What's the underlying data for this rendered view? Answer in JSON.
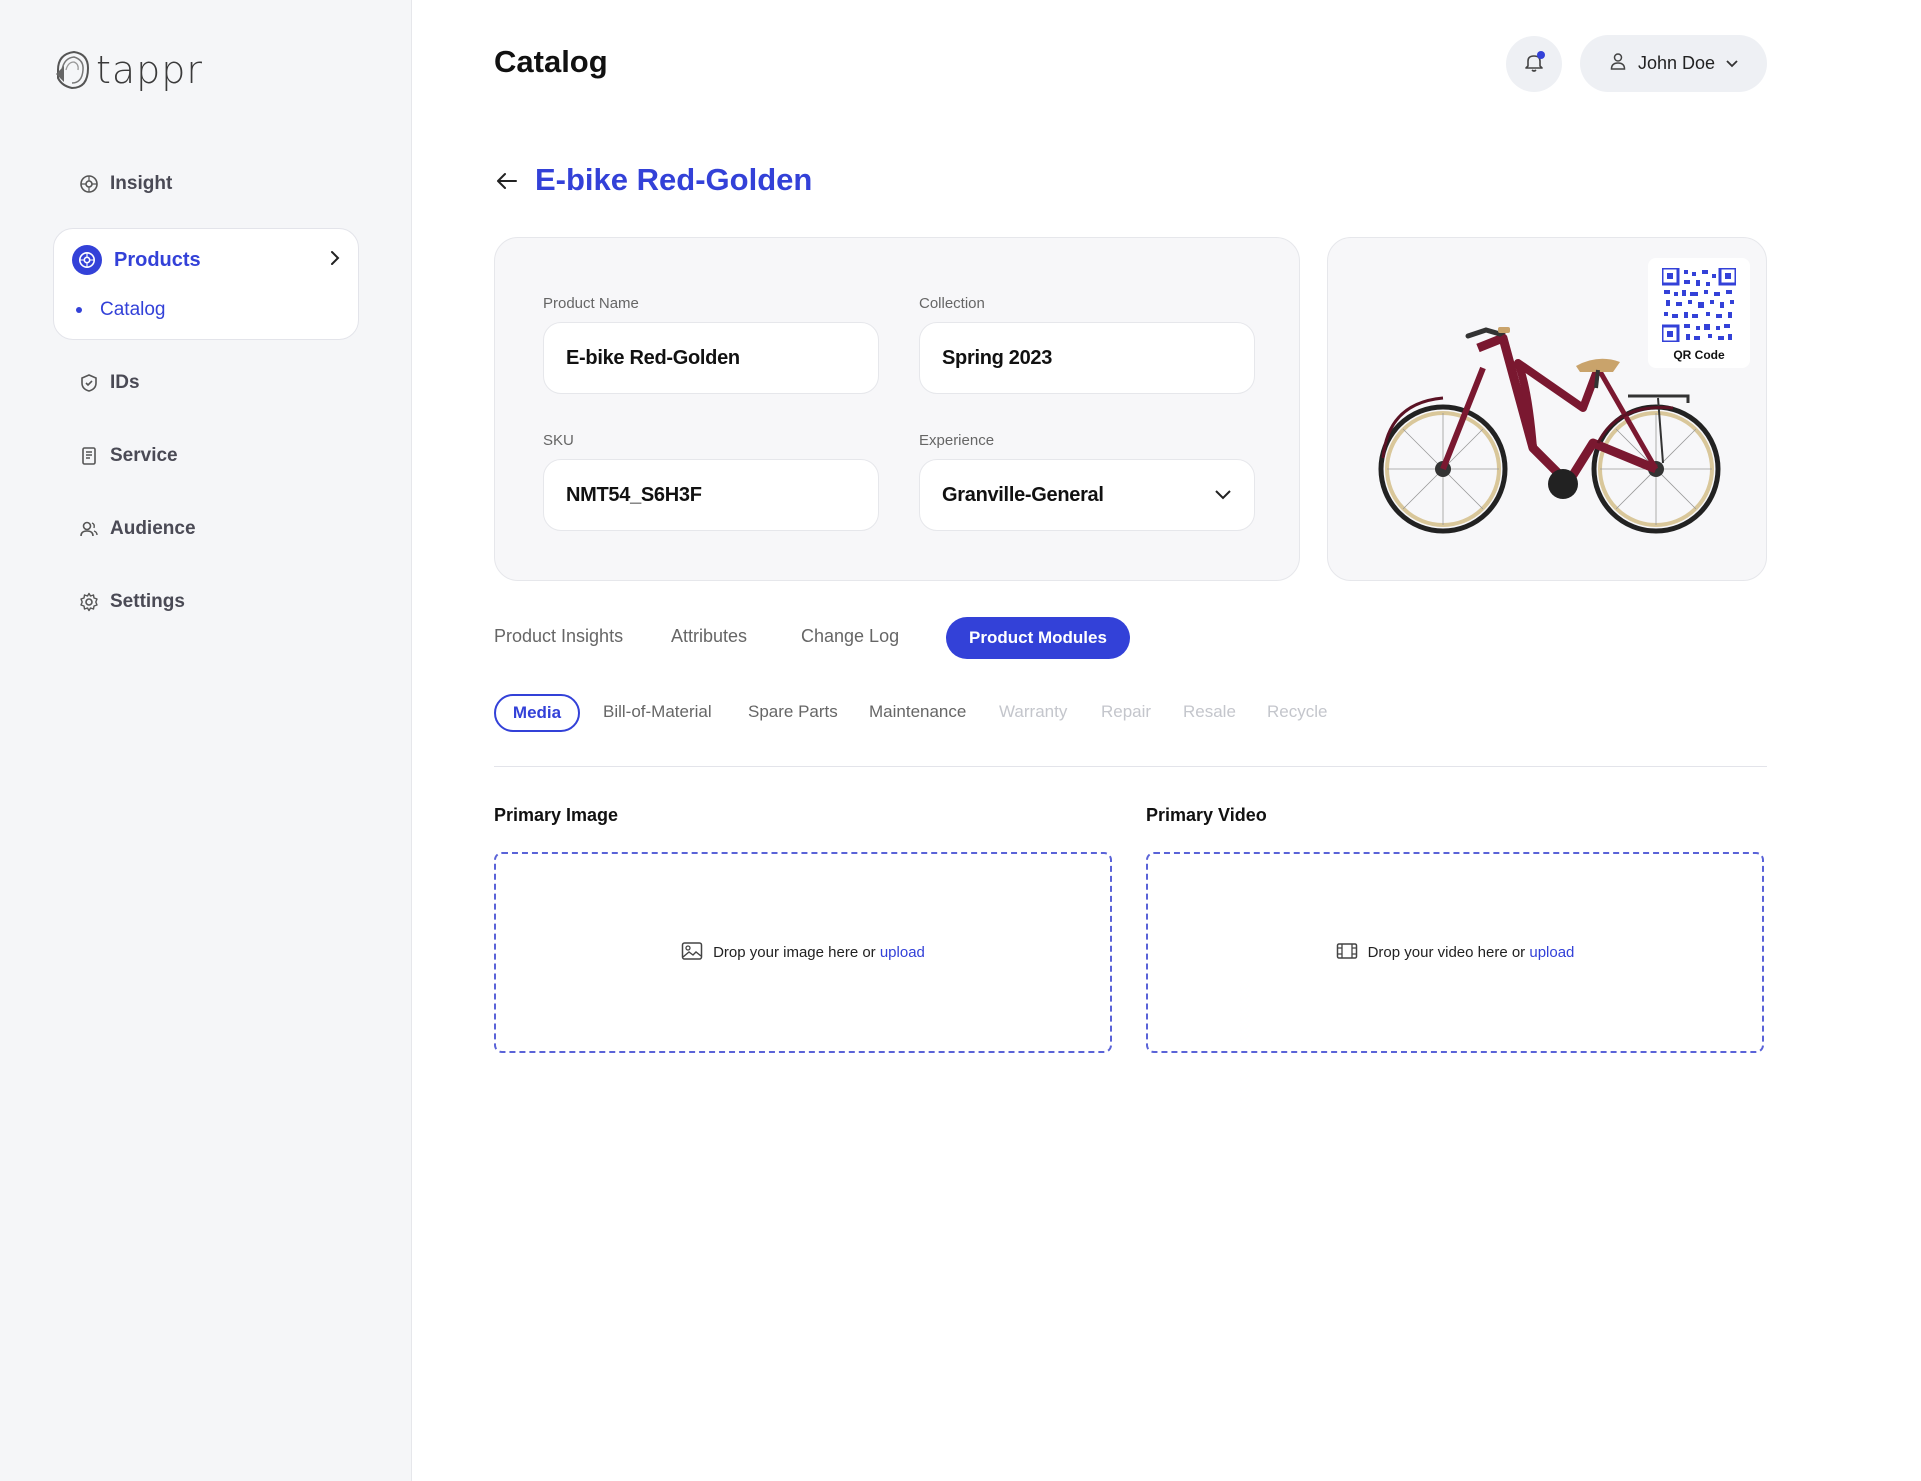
{
  "brand": {
    "name": "tappr"
  },
  "sidebar": {
    "items": [
      {
        "label": "Insight",
        "icon": "insight-icon"
      },
      {
        "label": "Products",
        "icon": "products-icon"
      },
      {
        "label": "IDs",
        "icon": "shield-icon"
      },
      {
        "label": "Service",
        "icon": "document-icon"
      },
      {
        "label": "Audience",
        "icon": "users-icon"
      },
      {
        "label": "Settings",
        "icon": "gear-icon"
      }
    ],
    "products_sub": {
      "label": "Catalog"
    }
  },
  "header": {
    "title": "Catalog",
    "user_name": "John Doe"
  },
  "product": {
    "title": "E-bike Red-Golden",
    "fields": {
      "name_label": "Product Name",
      "name_value": "E-bike Red-Golden",
      "collection_label": "Collection",
      "collection_value": "Spring 2023",
      "sku_label": "SKU",
      "sku_value": "NMT54_S6H3F",
      "experience_label": "Experience",
      "experience_value": "Granville-General"
    },
    "qr_label": "QR Code"
  },
  "tabs": [
    "Product Insights",
    "Attributes",
    "Change Log",
    "Product Modules"
  ],
  "subtabs": [
    "Media",
    "Bill-of-Material",
    "Spare Parts",
    "Maintenance",
    "Warranty",
    "Repair",
    "Resale",
    "Recycle"
  ],
  "media": {
    "image_label": "Primary Image",
    "image_drop_text": "Drop your image here or",
    "video_label": "Primary Video",
    "video_drop_text": "Drop your video here or",
    "upload_link": "upload"
  },
  "colors": {
    "accent": "#3341d8",
    "bike": "#7a1830"
  }
}
